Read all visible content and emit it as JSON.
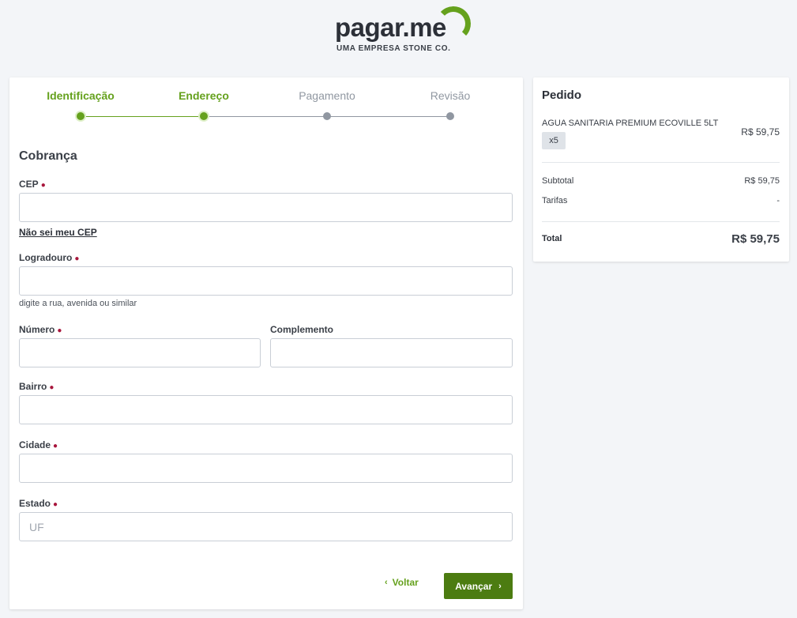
{
  "brand": {
    "wordmark": "pagar.me",
    "tagline": "UMA EMPRESA STONE CO.",
    "accent": "#65a11d"
  },
  "stepper": {
    "steps": [
      {
        "label": "Identificação",
        "state": "done"
      },
      {
        "label": "Endereço",
        "state": "current"
      },
      {
        "label": "Pagamento",
        "state": "todo"
      },
      {
        "label": "Revisão",
        "state": "todo"
      }
    ]
  },
  "form": {
    "section_title": "Cobrança",
    "required_marker": "●",
    "cep": {
      "label": "CEP",
      "value": "",
      "placeholder": ""
    },
    "cep_link": "Não sei meu CEP",
    "logradouro": {
      "label": "Logradouro",
      "value": "",
      "placeholder": "",
      "hint": "digite a rua, avenida ou similar"
    },
    "numero": {
      "label": "Número",
      "value": "",
      "placeholder": ""
    },
    "complemento": {
      "label": "Complemento",
      "value": "",
      "placeholder": ""
    },
    "bairro": {
      "label": "Bairro",
      "value": "",
      "placeholder": ""
    },
    "cidade": {
      "label": "Cidade",
      "value": "",
      "placeholder": ""
    },
    "estado": {
      "label": "Estado",
      "value": "",
      "placeholder": "UF"
    }
  },
  "actions": {
    "back_label": "Voltar",
    "back_icon": "chevron-left-icon",
    "next_label": "Avançar",
    "next_icon": "chevron-right-icon",
    "next_color": "#4c7c11"
  },
  "order": {
    "title": "Pedido",
    "item": {
      "name": "AGUA SANITARIA PREMIUM ECOVILLE 5LT",
      "price": "R$ 59,75",
      "quantity": "x5"
    },
    "subtotal_label": "Subtotal",
    "subtotal_value": "R$ 59,75",
    "fees_label": "Tarifas",
    "fees_value": "-",
    "total_label": "Total",
    "total_value": "R$ 59,75"
  }
}
